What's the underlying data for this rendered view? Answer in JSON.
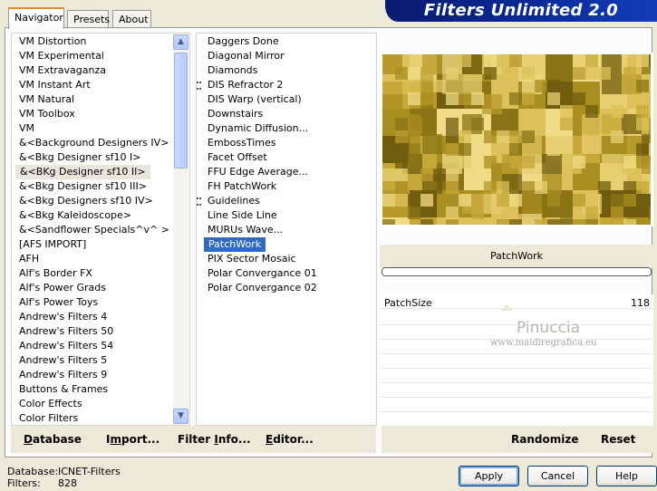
{
  "banner": {
    "title": "Filters Unlimited 2.0"
  },
  "tabs": [
    {
      "label": "Navigator",
      "active": true
    },
    {
      "label": "Presets",
      "active": false
    },
    {
      "label": "About",
      "active": false
    }
  ],
  "categories": [
    {
      "label": "VM Distortion"
    },
    {
      "label": "VM Experimental"
    },
    {
      "label": "VM Extravaganza"
    },
    {
      "label": "VM Instant Art"
    },
    {
      "label": "VM Natural"
    },
    {
      "label": "VM Toolbox"
    },
    {
      "label": "VM"
    },
    {
      "label": "&<Background Designers IV>"
    },
    {
      "label": "&<Bkg Designer sf10 I>"
    },
    {
      "label": "&<BKg Designer sf10 II>",
      "selected": true
    },
    {
      "label": "&<Bkg Designer sf10 III>"
    },
    {
      "label": "&<Bkg Designers sf10 IV>"
    },
    {
      "label": "&<Bkg Kaleidoscope>"
    },
    {
      "label": "&<Sandflower Specials^v^ >"
    },
    {
      "label": "[AFS IMPORT]"
    },
    {
      "label": "AFH"
    },
    {
      "label": "Alf's Border FX"
    },
    {
      "label": "Alf's Power Grads"
    },
    {
      "label": "Alf's Power Toys"
    },
    {
      "label": "Andrew's Filters 4"
    },
    {
      "label": "Andrew's Filters 50"
    },
    {
      "label": "Andrew's Filters 54"
    },
    {
      "label": "Andrew's Filters 5"
    },
    {
      "label": "Andrew's Filters 9"
    },
    {
      "label": "Buttons & Frames"
    },
    {
      "label": "Color Effects"
    },
    {
      "label": "Color Filters"
    }
  ],
  "filters": [
    {
      "label": "Daggers Done"
    },
    {
      "label": "Diagonal Mirror"
    },
    {
      "label": "Diamonds"
    },
    {
      "label": "DIS Refractor 2",
      "marker": true
    },
    {
      "label": "DIS Warp (vertical)"
    },
    {
      "label": "Downstairs"
    },
    {
      "label": "Dynamic Diffusion..."
    },
    {
      "label": "EmbossTimes"
    },
    {
      "label": "Facet Offset"
    },
    {
      "label": "FFU Edge Average..."
    },
    {
      "label": "FH PatchWork"
    },
    {
      "label": "Guidelines",
      "marker": true
    },
    {
      "label": "Line Side Line"
    },
    {
      "label": "MURUs Wave..."
    },
    {
      "label": "PatchWork",
      "selected": true
    },
    {
      "label": "PIX Sector Mosaic"
    },
    {
      "label": "Polar Convergance 01"
    },
    {
      "label": "Polar Convergance 02"
    }
  ],
  "commands": {
    "database": {
      "u": "D",
      "rest": "atabase"
    },
    "import": {
      "pre": "I",
      "u": "m",
      "rest": "port..."
    },
    "filter_info": {
      "pre": "Filter ",
      "u": "I",
      "rest": "nfo..."
    },
    "editor": {
      "u": "E",
      "rest": "ditor..."
    },
    "randomize": "Randomize",
    "reset": "Reset"
  },
  "param_panel": {
    "filter_name": "PatchWork",
    "param_label": "PatchSize",
    "param_value": "118",
    "watermark_name": "Pinuccia",
    "watermark_url": "www.maidiregrafica.eu"
  },
  "status": {
    "database_label": "Database:",
    "database_value": "ICNET-Filters",
    "filters_label": "Filters:",
    "filters_value": "828"
  },
  "buttons": {
    "apply": "Apply",
    "cancel": "Cancel",
    "help": "Help"
  },
  "colors": {
    "banner": "#0b2c9c",
    "selection": "#316ac5",
    "preview_gold": "#c9ab3c"
  }
}
